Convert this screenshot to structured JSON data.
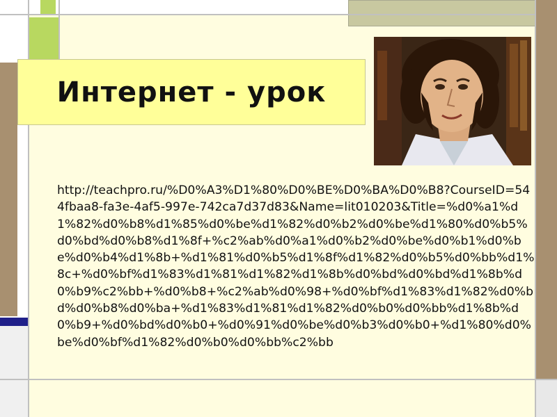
{
  "slide": {
    "title": "Интернет - урок",
    "url_text": "http://teachpro.ru/%D0%A3%D1%80%D0%BE%D0%BA%D0%B8?CourseID=544fbaa8-fa3e-4af5-997e-742ca7d37d83&Name=lit010203&Title=%d0%a1%d1%82%d0%b8%d1%85%d0%be%d1%82%d0%b2%d0%be%d1%80%d0%b5%d0%bd%d0%b8%d1%8f+%c2%ab%d0%a1%d0%b2%d0%be%d0%b1%d0%be%d0%b4%d1%8b+%d1%81%d0%b5%d1%8f%d1%82%d0%b5%d0%bb%d1%8c+%d0%bf%d1%83%d1%81%d1%82%d1%8b%d0%bd%d0%bd%d1%8b%d0%b9%c2%bb+%d0%b8+%c2%ab%d0%98+%d0%bf%d1%83%d1%82%d0%bd%d0%b8%d0%ba+%d1%83%d1%81%d1%82%d0%b0%d0%bb%d1%8b%d0%b9+%d0%bd%d0%b0+%d0%91%d0%be%d0%b3%d0%b0+%d1%80%d0%be%d0%bf%d1%82%d0%b0%d0%bb%c2%bb"
  },
  "colors": {
    "content_bg": "#fffde0",
    "title_bg": "#ffff99",
    "stripe_green": "#b8d860",
    "stripe_olive": "#c8c8a0",
    "stripe_brown": "#a89070",
    "stripe_navy": "#20208a",
    "line_gray": "#c0c0c0"
  },
  "portrait": {
    "icon": "portrait-image"
  }
}
